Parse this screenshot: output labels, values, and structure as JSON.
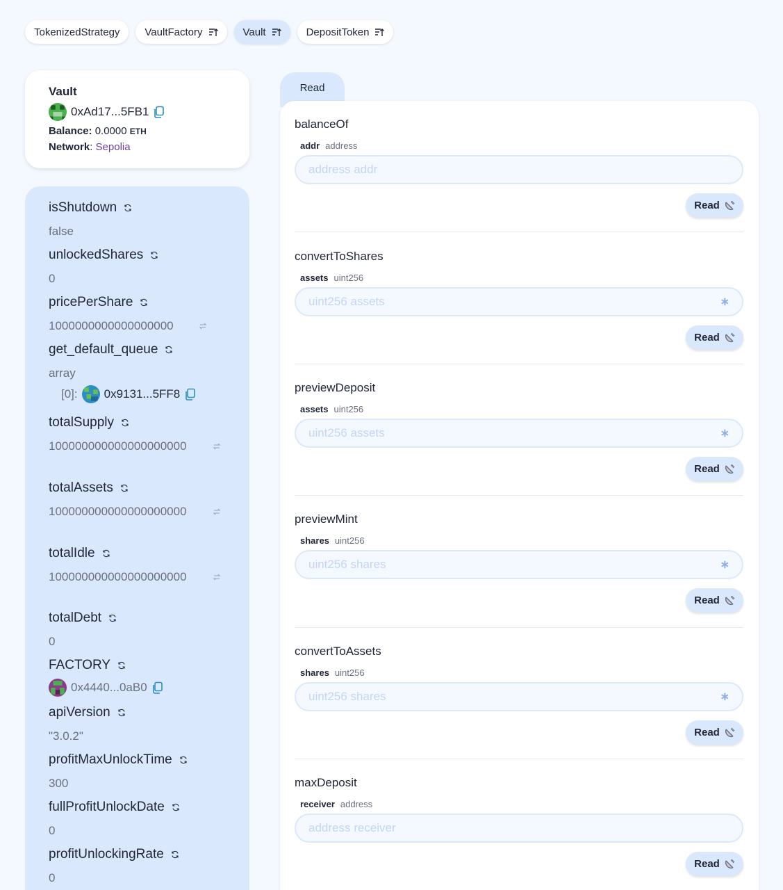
{
  "contract_tabs": [
    {
      "label": "TokenizedStrategy",
      "active": false,
      "sort_icon": false
    },
    {
      "label": "VaultFactory",
      "active": false,
      "sort_icon": true
    },
    {
      "label": "Vault",
      "active": true,
      "sort_icon": true
    },
    {
      "label": "DepositToken",
      "active": false,
      "sort_icon": true
    }
  ],
  "contract": {
    "name": "Vault",
    "address": "0xAd17...5FB1",
    "balance_label": "Balance:",
    "balance_value": "0.0000",
    "balance_unit": "ETH",
    "network_label": "Network",
    "network_value": "Sepolia"
  },
  "variables": [
    {
      "name": "isShutdown",
      "value": "false"
    },
    {
      "name": "unlockedShares",
      "value": "0"
    },
    {
      "name": "pricePerShare",
      "value": "1000000000000000000"
    },
    {
      "name": "get_default_queue",
      "value": "array",
      "array_index": "[0]:",
      "array_address": "0x9131...5FF8"
    },
    {
      "name": "totalSupply",
      "value": "100000000000000000000"
    },
    {
      "name": "totalAssets",
      "value": "100000000000000000000"
    },
    {
      "name": "totalIdle",
      "value": "100000000000000000000"
    },
    {
      "name": "totalDebt",
      "value": "0"
    },
    {
      "name": "FACTORY",
      "address": "0x4440...0aB0"
    },
    {
      "name": "apiVersion",
      "value": "\"3.0.2\""
    },
    {
      "name": "profitMaxUnlockTime",
      "value": "300"
    },
    {
      "name": "fullProfitUnlockDate",
      "value": "0"
    },
    {
      "name": "profitUnlockingRate",
      "value": "0"
    }
  ],
  "read_tab_label": "Read",
  "read_functions": [
    {
      "name": "balanceOf",
      "arg_name": "addr",
      "arg_type": "address",
      "placeholder": "address addr",
      "button": "Read"
    },
    {
      "name": "convertToShares",
      "arg_name": "assets",
      "arg_type": "uint256",
      "placeholder": "uint256 assets",
      "button": "Read",
      "star": "∗"
    },
    {
      "name": "previewDeposit",
      "arg_name": "assets",
      "arg_type": "uint256",
      "placeholder": "uint256 assets",
      "button": "Read",
      "star": "∗"
    },
    {
      "name": "previewMint",
      "arg_name": "shares",
      "arg_type": "uint256",
      "placeholder": "uint256 shares",
      "button": "Read",
      "star": "∗"
    },
    {
      "name": "convertToAssets",
      "arg_name": "shares",
      "arg_type": "uint256",
      "placeholder": "uint256 shares",
      "button": "Read",
      "star": "∗"
    },
    {
      "name": "maxDeposit",
      "arg_name": "receiver",
      "arg_type": "address",
      "placeholder": "address receiver",
      "button": "Read"
    }
  ],
  "colors": {
    "accent": "#d9e8fc",
    "background": "#f4f8ff",
    "network": "#6a3fa0",
    "text": "#212638"
  }
}
